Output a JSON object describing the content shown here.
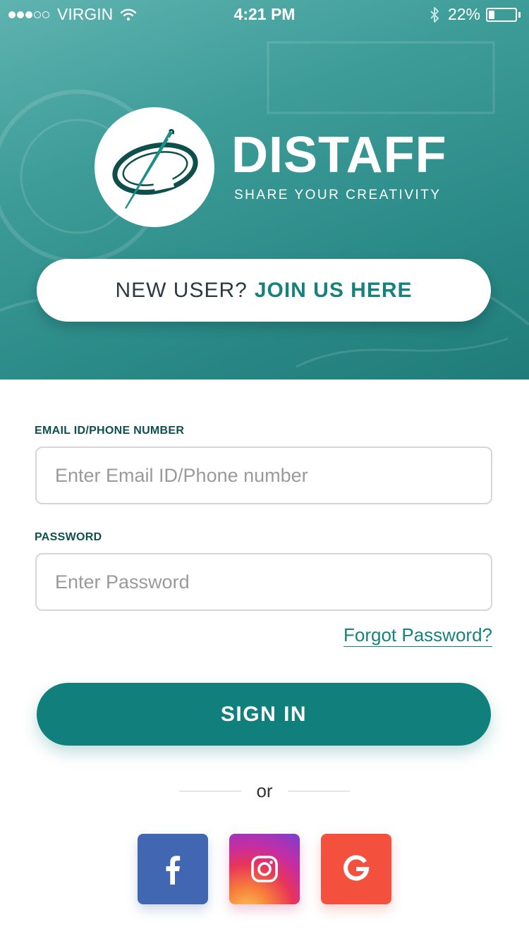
{
  "status_bar": {
    "carrier": "VIRGIN",
    "time": "4:21 PM",
    "battery_percent": "22%",
    "battery_level": 0.22,
    "signal_bars_filled": 3,
    "signal_bars_total": 5
  },
  "brand": {
    "name": "DISTAFF",
    "tagline": "SHARE YOUR CREATIVITY",
    "logo_icon": "needle-thread-icon"
  },
  "join": {
    "prefix": "NEW USER?",
    "link": "JOIN US HERE"
  },
  "form": {
    "email_label": "EMAIL ID/PHONE NUMBER",
    "email_placeholder": "Enter Email ID/Phone number",
    "email_value": "",
    "password_label": "PASSWORD",
    "password_placeholder": "Enter Password",
    "password_value": "",
    "forgot_label": "Forgot Password?",
    "signin_label": "SIGN IN"
  },
  "divider": {
    "text": "or"
  },
  "social": [
    {
      "name": "Facebook",
      "icon": "facebook-icon",
      "color": "#4267B2"
    },
    {
      "name": "Instagram",
      "icon": "instagram-icon",
      "color": "#C62DA2"
    },
    {
      "name": "Google",
      "icon": "google-icon",
      "color": "#F4503E"
    }
  ],
  "colors": {
    "brand_teal": "#11807C",
    "link_teal": "#17827D",
    "label_dark_teal": "#0F4F4D"
  }
}
